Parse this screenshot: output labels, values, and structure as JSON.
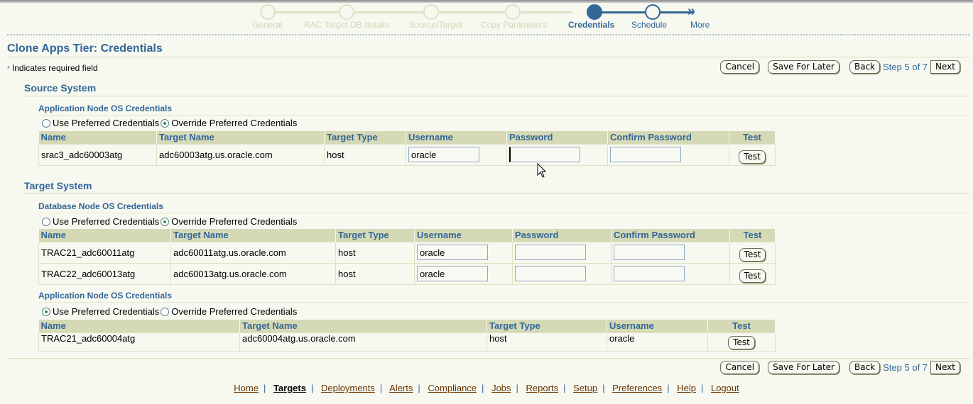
{
  "train": {
    "steps": [
      {
        "label": "General",
        "state": "visited"
      },
      {
        "label": "RAC Target DB details",
        "state": "visited"
      },
      {
        "label": "Source/Target",
        "state": "visited"
      },
      {
        "label": "Copy Parameters",
        "state": "visited"
      },
      {
        "label": "Credentials",
        "state": "current"
      },
      {
        "label": "Schedule",
        "state": "next"
      },
      {
        "label": "More",
        "state": "more"
      }
    ],
    "colors": {
      "active": "#336699",
      "inactive": "#e0e2c5"
    }
  },
  "page": {
    "title": "Clone Apps Tier: Credentials",
    "required_note": "Indicates required field",
    "required_symbol": "*"
  },
  "buttons": {
    "cancel": "Cancel",
    "save_for_later": "Save For Later",
    "back": "Back",
    "step_text": "Step 5 of 7",
    "next": "Next"
  },
  "source_system": {
    "title": "Source System",
    "app_node": {
      "title": "Application Node OS Credentials",
      "radio_use": "Use Preferred Credentials",
      "radio_override": "Override Preferred Credentials",
      "selected": "override",
      "columns": [
        "Name",
        "Target Name",
        "Target Type",
        "Username",
        "Password",
        "Confirm Password",
        "Test"
      ],
      "rows": [
        {
          "name": "srac3_adc60003atg",
          "target_name": "adc60003atg.us.oracle.com",
          "target_type": "host",
          "username": "oracle",
          "password": "",
          "confirm_password": "",
          "test": "Test"
        }
      ]
    }
  },
  "target_system": {
    "title": "Target System",
    "db_node": {
      "title": "Database Node OS Credentials",
      "radio_use": "Use Preferred Credentials",
      "radio_override": "Override Preferred Credentials",
      "selected": "override",
      "columns": [
        "Name",
        "Target Name",
        "Target Type",
        "Username",
        "Password",
        "Confirm Password",
        "Test"
      ],
      "rows": [
        {
          "name": "TRAC21_adc60011atg",
          "target_name": "adc60011atg.us.oracle.com",
          "target_type": "host",
          "username": "oracle",
          "password": "",
          "confirm_password": "",
          "test": "Test"
        },
        {
          "name": "TRAC22_adc60013atg",
          "target_name": "adc60013atg.us.oracle.com",
          "target_type": "host",
          "username": "oracle",
          "password": "",
          "confirm_password": "",
          "test": "Test"
        }
      ]
    },
    "app_node": {
      "title": "Application Node OS Credentials",
      "radio_use": "Use Preferred Credentials",
      "radio_override": "Override Preferred Credentials",
      "selected": "use",
      "columns": [
        "Name",
        "Target Name",
        "Target Type",
        "Username",
        "Test"
      ],
      "rows": [
        {
          "name": "TRAC21_adc60004atg",
          "target_name": "adc60004atg.us.oracle.com",
          "target_type": "host",
          "username": "oracle",
          "test": "Test"
        }
      ]
    }
  },
  "footer": {
    "links": [
      {
        "label": "Home",
        "active": false
      },
      {
        "label": "Targets",
        "active": true
      },
      {
        "label": "Deployments",
        "active": false
      },
      {
        "label": "Alerts",
        "active": false
      },
      {
        "label": "Compliance",
        "active": false
      },
      {
        "label": "Jobs",
        "active": false
      },
      {
        "label": "Reports",
        "active": false
      },
      {
        "label": "Setup",
        "active": false
      },
      {
        "label": "Preferences",
        "active": false
      },
      {
        "label": "Help",
        "active": false
      },
      {
        "label": "Logout",
        "active": false
      }
    ],
    "separator": "|"
  }
}
